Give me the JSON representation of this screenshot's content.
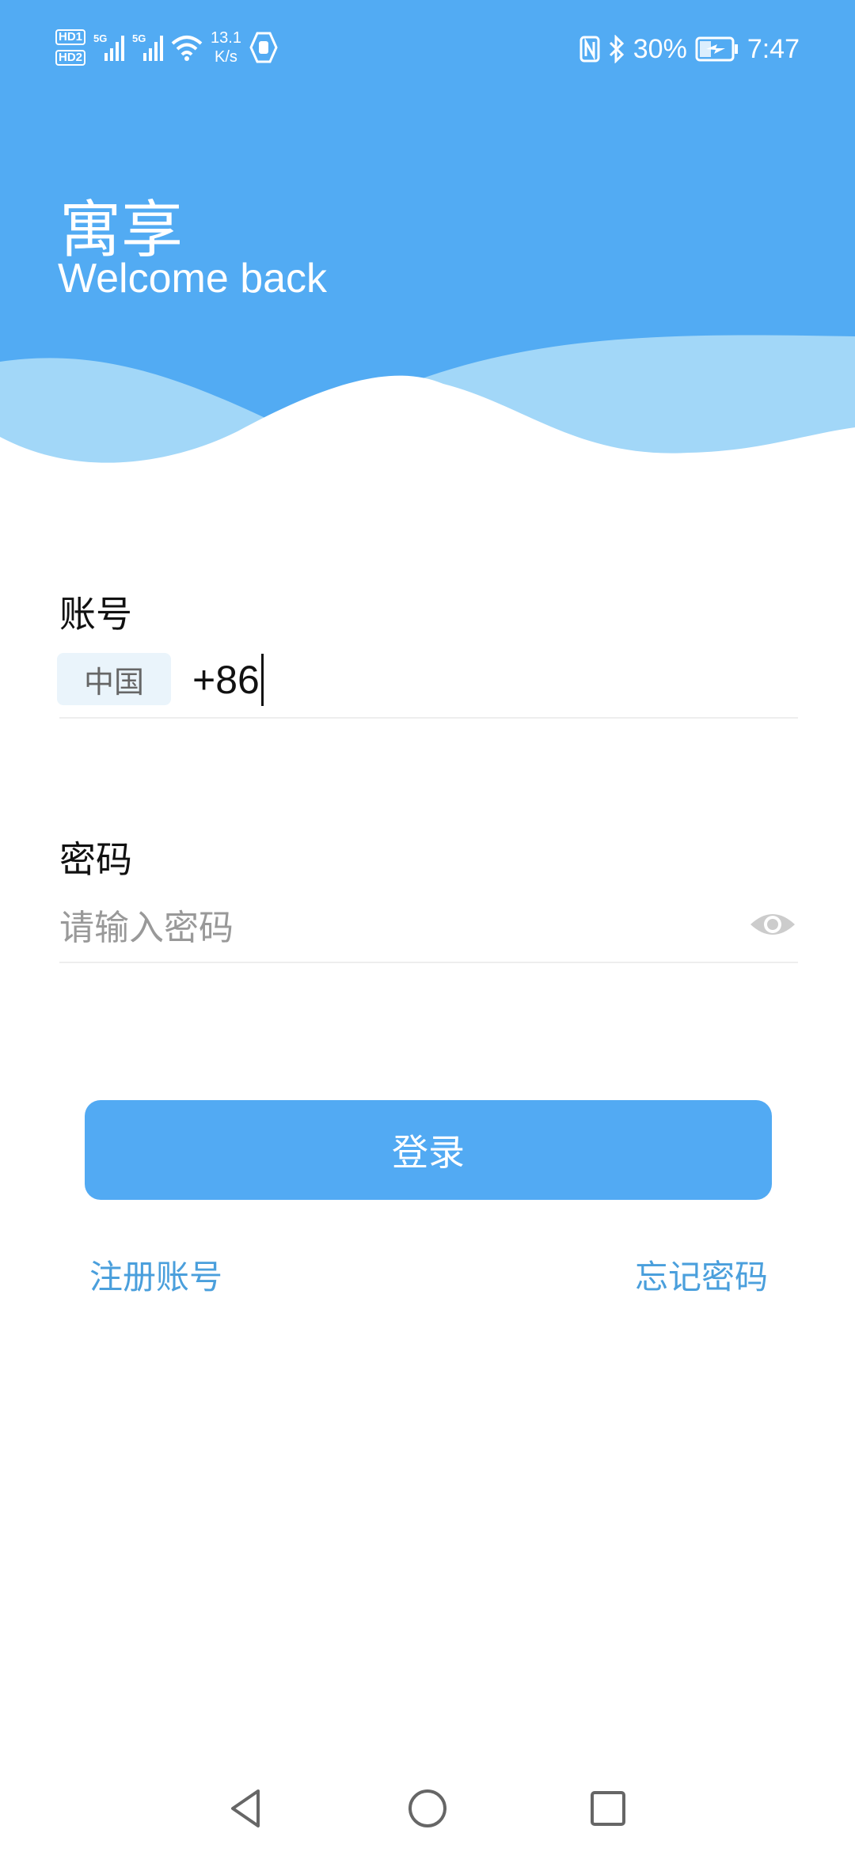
{
  "status_bar": {
    "hd1": "HD1",
    "hd2": "HD2",
    "sim1_net": "5G",
    "sim2_net": "5G",
    "speed_value": "13.1",
    "speed_unit": "K/s",
    "battery": "30%",
    "time": "7:47",
    "icons": [
      "hd-icon",
      "signal-icon",
      "wifi-icon",
      "hand-icon",
      "nfc-icon",
      "bluetooth-icon",
      "battery-charging-icon"
    ]
  },
  "header": {
    "title": "寓享",
    "subtitle": "Welcome back"
  },
  "form": {
    "account_label": "账号",
    "country": "中国",
    "phone_value": "+86",
    "password_label": "密码",
    "password_placeholder": "请输入密码",
    "login_label": "登录"
  },
  "links": {
    "register": "注册账号",
    "forgot": "忘记密码"
  },
  "colors": {
    "primary": "#52abf3",
    "wave_light": "#a2d7f8",
    "link": "#4a9fdc"
  }
}
